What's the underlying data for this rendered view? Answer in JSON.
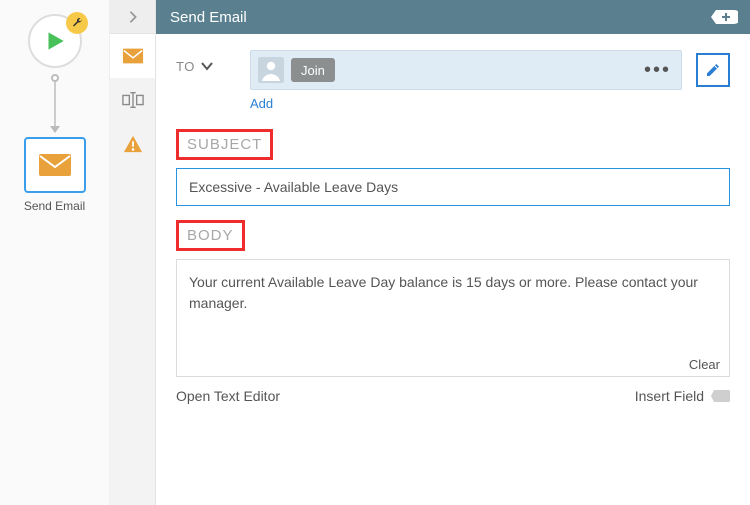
{
  "workflow": {
    "start_node": {
      "label": "Start"
    },
    "email_node": {
      "label": "Send Email"
    }
  },
  "rail": {
    "items": [
      "email",
      "field",
      "warning"
    ]
  },
  "panel": {
    "title": "Send Email"
  },
  "email": {
    "to_label": "TO",
    "recipients": [
      {
        "name": "Join"
      }
    ],
    "add_label": "Add",
    "subject_label": "SUBJECT",
    "subject_value": "Excessive - Available Leave Days",
    "body_label": "BODY",
    "body_value": "Your current Available Leave Day balance is 15 days or more. Please contact your manager.",
    "clear_label": "Clear",
    "open_editor_label": "Open Text Editor",
    "insert_field_label": "Insert Field"
  }
}
